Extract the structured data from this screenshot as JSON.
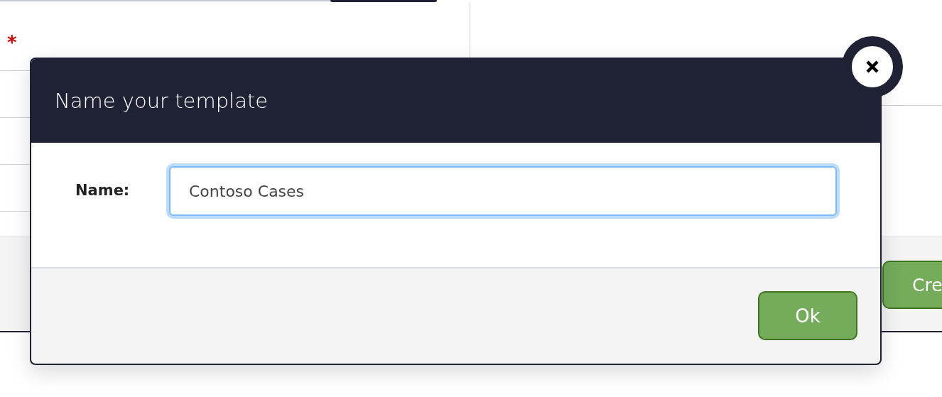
{
  "background_form": {
    "required_mark": "*",
    "create_button": "Cre"
  },
  "dialog": {
    "title": "Name your template",
    "field": {
      "label": "Name:",
      "value": "Contoso Cases",
      "focused": true
    },
    "ok_button": "Ok"
  }
}
